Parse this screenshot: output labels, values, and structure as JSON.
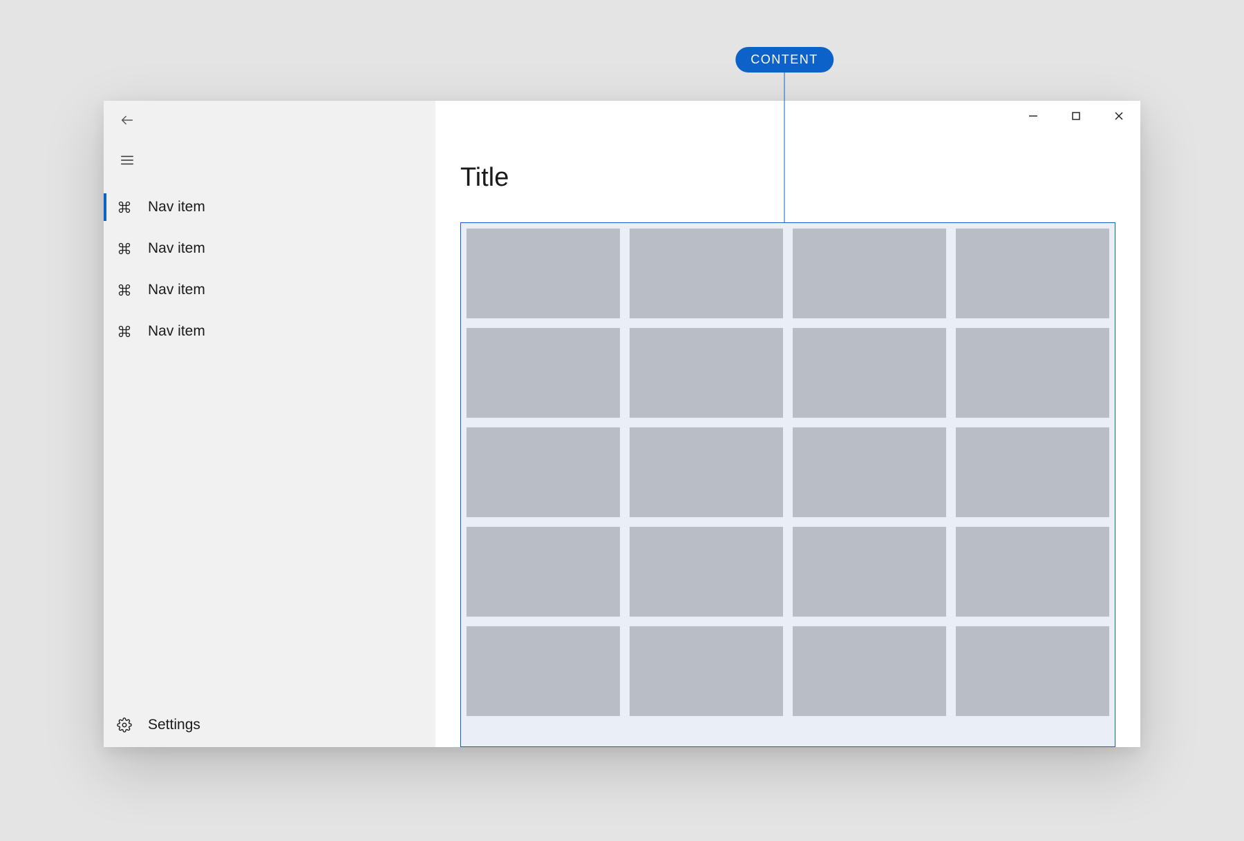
{
  "callout": {
    "label": "CONTENT"
  },
  "page": {
    "title": "Title"
  },
  "sidebar": {
    "items": [
      {
        "label": "Nav item",
        "selected": true
      },
      {
        "label": "Nav item",
        "selected": false
      },
      {
        "label": "Nav item",
        "selected": false
      },
      {
        "label": "Nav item",
        "selected": false
      }
    ],
    "settings_label": "Settings"
  },
  "content": {
    "grid": {
      "columns": 4,
      "rows": 5
    }
  },
  "colors": {
    "accent": "#0d62c9",
    "sidebar_bg": "#f1f1f1",
    "tile": "#B9BDC6",
    "outline_fill": "#e9eef7"
  }
}
